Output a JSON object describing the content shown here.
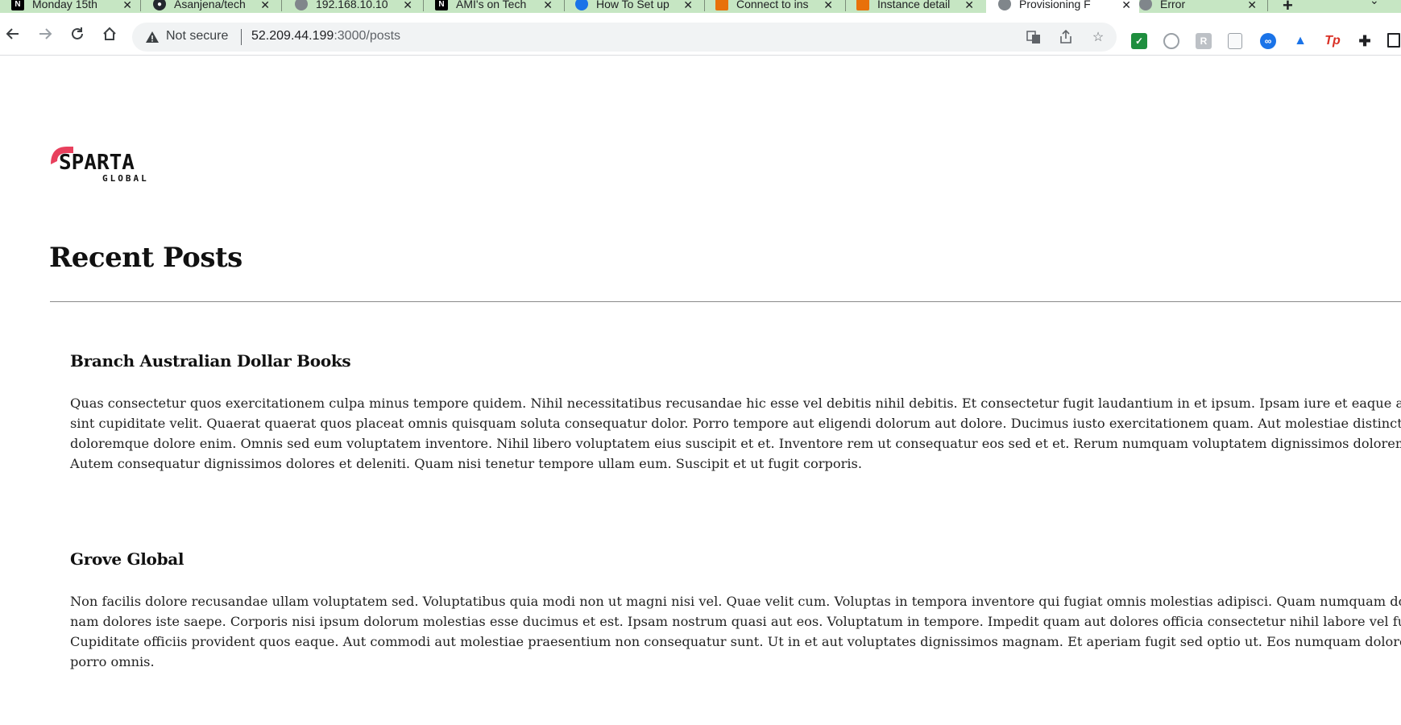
{
  "browser": {
    "tabs": [
      {
        "title": "Monday 15th",
        "favicon": "notion-icon"
      },
      {
        "title": "Asanjena/tech",
        "favicon": "github-icon"
      },
      {
        "title": "192.168.10.10",
        "favicon": "globe-icon"
      },
      {
        "title": "AMI's on Tech",
        "favicon": "notion-icon"
      },
      {
        "title": "How To Set up",
        "favicon": "bird-icon"
      },
      {
        "title": "Connect to ins",
        "favicon": "aws-icon"
      },
      {
        "title": "Instance detail",
        "favicon": "aws-icon"
      },
      {
        "title": "Provisioning F",
        "favicon": "globe-icon",
        "active": true
      },
      {
        "title": "Error",
        "favicon": "globe-icon"
      }
    ],
    "address": {
      "security_label": "Not secure",
      "host": "52.209.44.199",
      "path": ":3000/posts"
    }
  },
  "page": {
    "logo": {
      "line1": "SPARTA",
      "line2": "GLOBAL"
    },
    "title": "Recent Posts",
    "posts": [
      {
        "title": "Branch Australian Dollar Books",
        "body": "Quas consectetur quos exercitationem culpa minus tempore quidem. Nihil necessitatibus recusandae hic esse vel debitis nihil debitis. Et consectetur fugit laudantium in et ipsum. Ipsam iure et eaque amet sint cupiditate velit. Quaerat quaerat quos placeat omnis quisquam soluta consequatur dolor. Porro tempore aut eligendi dolorum aut dolore. Ducimus iusto exercitationem quam. Aut molestiae distinctio doloremque dolore enim. Omnis sed eum voluptatem inventore. Nihil libero voluptatem eius suscipit et et. Inventore rem ut consequatur eos sed et et. Rerum numquam voluptatem dignissimos dolorem qui. Autem consequatur dignissimos dolores et deleniti. Quam nisi tenetur tempore ullam eum. Suscipit et ut fugit corporis."
      },
      {
        "title": "Grove Global",
        "body": "Non facilis dolore recusandae ullam voluptatem sed. Voluptatibus quia modi non ut magni nisi vel. Quae velit cum. Voluptas in tempora inventore qui fugiat omnis molestias adipisci. Quam numquam dolorem nam dolores iste saepe. Corporis nisi ipsum dolorum molestias esse ducimus et est. Ipsam nostrum quasi aut eos. Voluptatum in tempore. Impedit quam aut dolores officia consectetur nihil labore vel fugiat. Cupiditate officiis provident quos eaque. Aut commodi aut molestiae praesentium non consequatur sunt. Ut in et aut voluptates dignissimos magnam. Et aperiam fugit sed optio ut. Eos numquam dolore libero porro omnis."
      }
    ]
  },
  "colors": {
    "tabstrip": "#c6e6c3",
    "brand_accent": "#e8405d",
    "text": "#222222"
  }
}
